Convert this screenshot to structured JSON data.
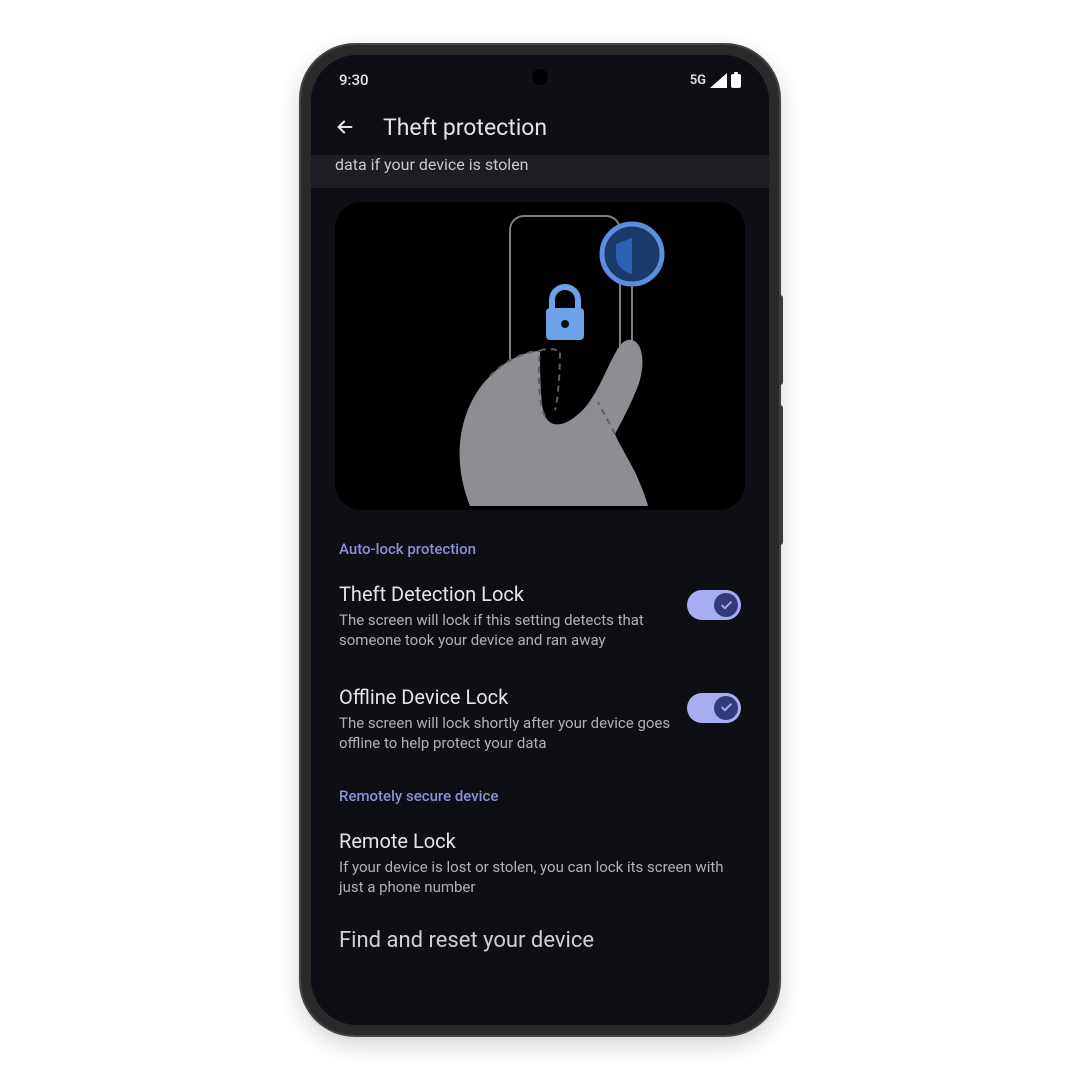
{
  "status": {
    "time": "9:30",
    "network": "5G"
  },
  "header": {
    "title": "Theft protection"
  },
  "banner": {
    "text": "data if your device is stolen"
  },
  "sections": {
    "autolock": {
      "label": "Auto-lock protection",
      "items": [
        {
          "title": "Theft Detection Lock",
          "desc": "The screen will lock if this setting detects that someone took your device and ran away",
          "enabled": true
        },
        {
          "title": "Offline Device Lock",
          "desc": "The screen will lock shortly after your device goes offline to help protect your data",
          "enabled": true
        }
      ]
    },
    "remote": {
      "label": "Remotely secure device",
      "items": [
        {
          "title": "Remote Lock",
          "desc": "If your device is lost or stolen, you can lock its screen with just a phone number"
        }
      ]
    }
  },
  "footer": {
    "link": "Find and reset your device"
  }
}
